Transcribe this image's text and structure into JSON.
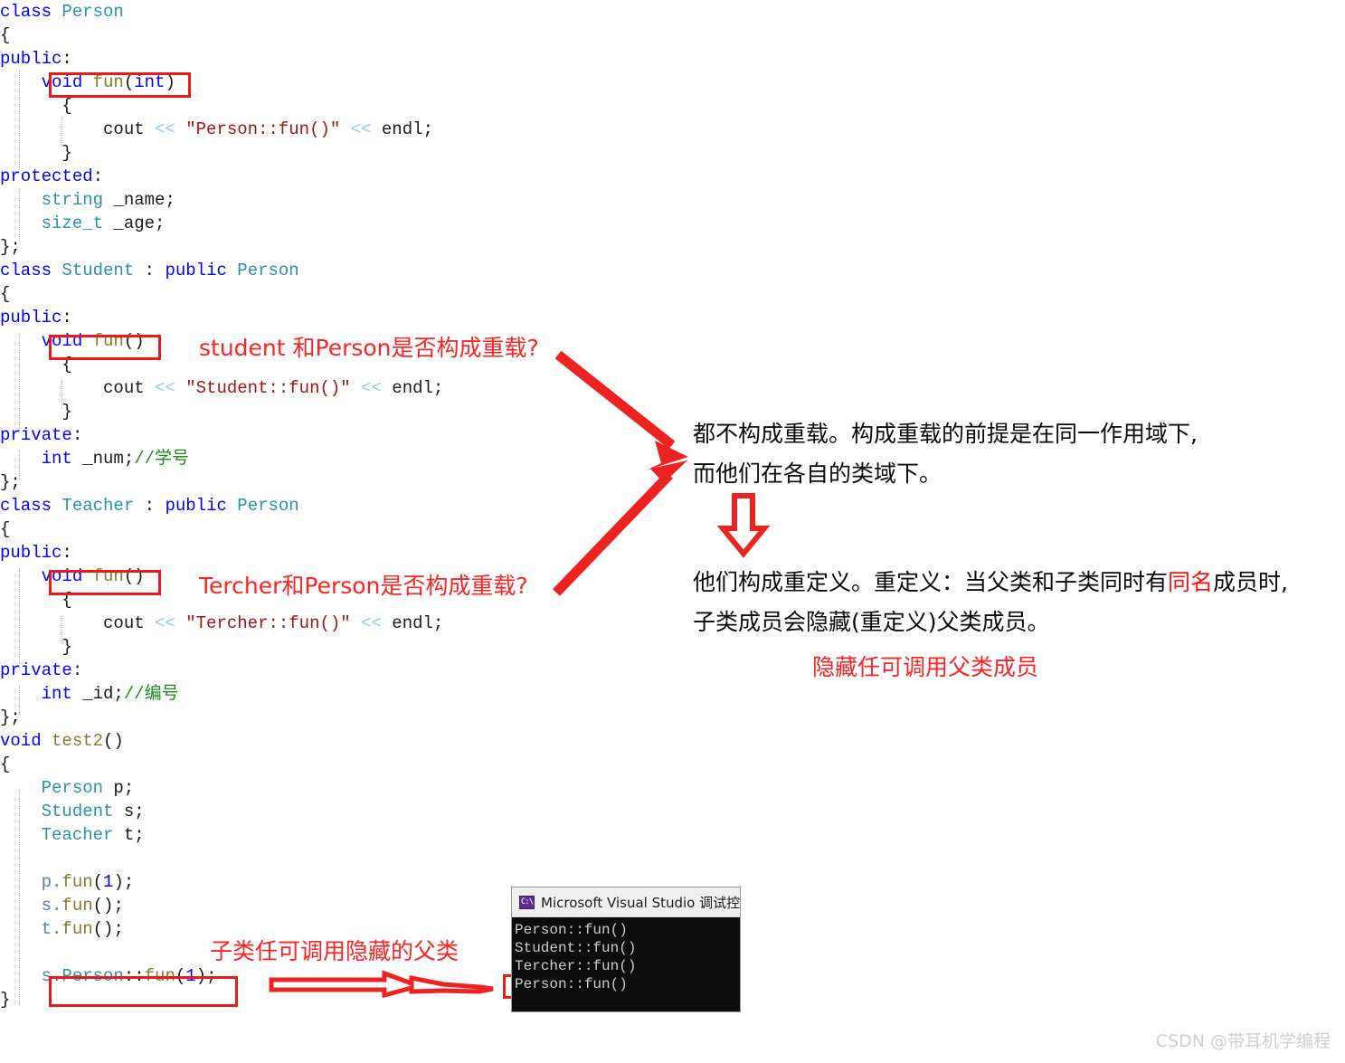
{
  "code": {
    "lines": [
      [
        {
          "t": "class ",
          "c": "kw"
        },
        {
          "t": "Person",
          "c": "ty"
        }
      ],
      [
        {
          "t": "{",
          "c": "pl"
        }
      ],
      [
        {
          "t": "public",
          "c": "kw"
        },
        {
          "t": ":",
          "c": "pl"
        }
      ],
      [
        {
          "t": "    ",
          "c": "pl"
        },
        {
          "t": "void",
          "c": "kw"
        },
        {
          "t": " ",
          "c": "pl"
        },
        {
          "t": "fun",
          "c": "fn"
        },
        {
          "t": "(",
          "c": "pl"
        },
        {
          "t": "int",
          "c": "kw"
        },
        {
          "t": ")",
          "c": "pl"
        }
      ],
      [
        {
          "t": "      {",
          "c": "pl"
        }
      ],
      [
        {
          "t": "          cout ",
          "c": "pl"
        },
        {
          "t": "<<",
          "c": "op"
        },
        {
          "t": " ",
          "c": "pl"
        },
        {
          "t": "\"Person::fun()\"",
          "c": "str"
        },
        {
          "t": " ",
          "c": "pl"
        },
        {
          "t": "<<",
          "c": "op"
        },
        {
          "t": " endl;",
          "c": "pl"
        }
      ],
      [
        {
          "t": "      }",
          "c": "pl"
        }
      ],
      [
        {
          "t": "protected",
          "c": "kw"
        },
        {
          "t": ":",
          "c": "pl"
        }
      ],
      [
        {
          "t": "    ",
          "c": "pl"
        },
        {
          "t": "string",
          "c": "ty"
        },
        {
          "t": " _name;",
          "c": "pl"
        }
      ],
      [
        {
          "t": "    ",
          "c": "pl"
        },
        {
          "t": "size_t",
          "c": "ty"
        },
        {
          "t": " _age;",
          "c": "pl"
        }
      ],
      [
        {
          "t": "};",
          "c": "pl"
        }
      ],
      [
        {
          "t": "class ",
          "c": "kw"
        },
        {
          "t": "Student",
          "c": "ty"
        },
        {
          "t": " : ",
          "c": "pl"
        },
        {
          "t": "public",
          "c": "kw"
        },
        {
          "t": " ",
          "c": "pl"
        },
        {
          "t": "Person",
          "c": "ty"
        }
      ],
      [
        {
          "t": "{",
          "c": "pl"
        }
      ],
      [
        {
          "t": "public",
          "c": "kw"
        },
        {
          "t": ":",
          "c": "pl"
        }
      ],
      [
        {
          "t": "    ",
          "c": "pl"
        },
        {
          "t": "void",
          "c": "kw"
        },
        {
          "t": " ",
          "c": "pl"
        },
        {
          "t": "fun",
          "c": "fn"
        },
        {
          "t": "()",
          "c": "pl"
        }
      ],
      [
        {
          "t": "      {",
          "c": "pl"
        }
      ],
      [
        {
          "t": "          cout ",
          "c": "pl"
        },
        {
          "t": "<<",
          "c": "op"
        },
        {
          "t": " ",
          "c": "pl"
        },
        {
          "t": "\"Student::fun()\"",
          "c": "str"
        },
        {
          "t": " ",
          "c": "pl"
        },
        {
          "t": "<<",
          "c": "op"
        },
        {
          "t": " endl;",
          "c": "pl"
        }
      ],
      [
        {
          "t": "      }",
          "c": "pl"
        }
      ],
      [
        {
          "t": "private",
          "c": "kw"
        },
        {
          "t": ":",
          "c": "pl"
        }
      ],
      [
        {
          "t": "    ",
          "c": "pl"
        },
        {
          "t": "int",
          "c": "kw"
        },
        {
          "t": " _num;",
          "c": "pl"
        },
        {
          "t": "//学号",
          "c": "cmt"
        }
      ],
      [
        {
          "t": "};",
          "c": "pl"
        }
      ],
      [
        {
          "t": "class ",
          "c": "kw"
        },
        {
          "t": "Teacher",
          "c": "ty"
        },
        {
          "t": " : ",
          "c": "pl"
        },
        {
          "t": "public",
          "c": "kw"
        },
        {
          "t": " ",
          "c": "pl"
        },
        {
          "t": "Person",
          "c": "ty"
        }
      ],
      [
        {
          "t": "{",
          "c": "pl"
        }
      ],
      [
        {
          "t": "public",
          "c": "kw"
        },
        {
          "t": ":",
          "c": "pl"
        }
      ],
      [
        {
          "t": "    ",
          "c": "pl"
        },
        {
          "t": "void",
          "c": "kw"
        },
        {
          "t": " ",
          "c": "pl"
        },
        {
          "t": "fun",
          "c": "fn"
        },
        {
          "t": "()",
          "c": "pl"
        }
      ],
      [
        {
          "t": "      {",
          "c": "pl"
        }
      ],
      [
        {
          "t": "          cout ",
          "c": "pl"
        },
        {
          "t": "<<",
          "c": "op"
        },
        {
          "t": " ",
          "c": "pl"
        },
        {
          "t": "\"Tercher::fun()\"",
          "c": "str"
        },
        {
          "t": " ",
          "c": "pl"
        },
        {
          "t": "<<",
          "c": "op"
        },
        {
          "t": " endl;",
          "c": "pl"
        }
      ],
      [
        {
          "t": "      }",
          "c": "pl"
        }
      ],
      [
        {
          "t": "private",
          "c": "kw"
        },
        {
          "t": ":",
          "c": "pl"
        }
      ],
      [
        {
          "t": "    ",
          "c": "pl"
        },
        {
          "t": "int",
          "c": "kw"
        },
        {
          "t": " _id;",
          "c": "pl"
        },
        {
          "t": "//编号",
          "c": "cmt"
        }
      ],
      [
        {
          "t": "};",
          "c": "pl"
        }
      ],
      [
        {
          "t": "void",
          "c": "kw"
        },
        {
          "t": " ",
          "c": "pl"
        },
        {
          "t": "test2",
          "c": "fn"
        },
        {
          "t": "()",
          "c": "pl"
        }
      ],
      [
        {
          "t": "{",
          "c": "pl"
        }
      ],
      [
        {
          "t": "    ",
          "c": "pl"
        },
        {
          "t": "Person",
          "c": "ty"
        },
        {
          "t": " p;",
          "c": "pl"
        }
      ],
      [
        {
          "t": "    ",
          "c": "pl"
        },
        {
          "t": "Student",
          "c": "ty"
        },
        {
          "t": " s;",
          "c": "pl"
        }
      ],
      [
        {
          "t": "    ",
          "c": "pl"
        },
        {
          "t": "Teacher",
          "c": "ty"
        },
        {
          "t": " t;",
          "c": "pl"
        }
      ],
      [
        {
          "t": "",
          "c": "pl"
        }
      ],
      [
        {
          "t": "    ",
          "c": "pl"
        },
        {
          "t": "p.",
          "c": "var"
        },
        {
          "t": "fun",
          "c": "fn"
        },
        {
          "t": "(",
          "c": "pl"
        },
        {
          "t": "1",
          "c": "num"
        },
        {
          "t": ");",
          "c": "pl"
        }
      ],
      [
        {
          "t": "    ",
          "c": "pl"
        },
        {
          "t": "s.",
          "c": "var"
        },
        {
          "t": "fun",
          "c": "fn"
        },
        {
          "t": "();",
          "c": "pl"
        }
      ],
      [
        {
          "t": "    ",
          "c": "pl"
        },
        {
          "t": "t.",
          "c": "var"
        },
        {
          "t": "fun",
          "c": "fn"
        },
        {
          "t": "();",
          "c": "pl"
        }
      ],
      [
        {
          "t": "",
          "c": "pl"
        }
      ],
      [
        {
          "t": "    ",
          "c": "pl"
        },
        {
          "t": "s.",
          "c": "var"
        },
        {
          "t": "Person",
          "c": "ty"
        },
        {
          "t": "::",
          "c": "pl"
        },
        {
          "t": "fun",
          "c": "fn"
        },
        {
          "t": "(",
          "c": "pl"
        },
        {
          "t": "1",
          "c": "num"
        },
        {
          "t": ");",
          "c": "pl"
        }
      ],
      [
        {
          "t": "}",
          "c": "pl"
        }
      ]
    ]
  },
  "annotations": {
    "q_student": "student 和Person是否构成重载?",
    "q_teacher": "Tercher和Person是否构成重载?",
    "answer_line1": "都不构成重载。构成重载的前提是在同一作用域下,",
    "answer_line2": "而他们在各自的类域下。",
    "redef_line1_a": "他们构成重定义。重定义：当父类和子类同时有",
    "redef_line1_hl": "同名",
    "redef_line1_b": "成员时,",
    "redef_line2": "子类成员会隐藏(重定义)父类成员。",
    "redef_note": "隐藏任可调用父类成员",
    "call_parent": "子类任可调用隐藏的父类"
  },
  "console": {
    "title": "Microsoft Visual Studio 调试控",
    "icon_label": "C:\\",
    "output": "Person::fun()\nStudent::fun()\nTercher::fun()\nPerson::fun()"
  },
  "watermark": "CSDN @带耳机学编程",
  "colors": {
    "annotation_red": "#fb2424",
    "box_red": "#e81a1a",
    "keyword": "#0000ff",
    "type": "#2b91af",
    "string": "#a31515",
    "comment": "#1f8a1f",
    "function": "#8a7a2e",
    "console_bg": "#0c0c0c"
  }
}
